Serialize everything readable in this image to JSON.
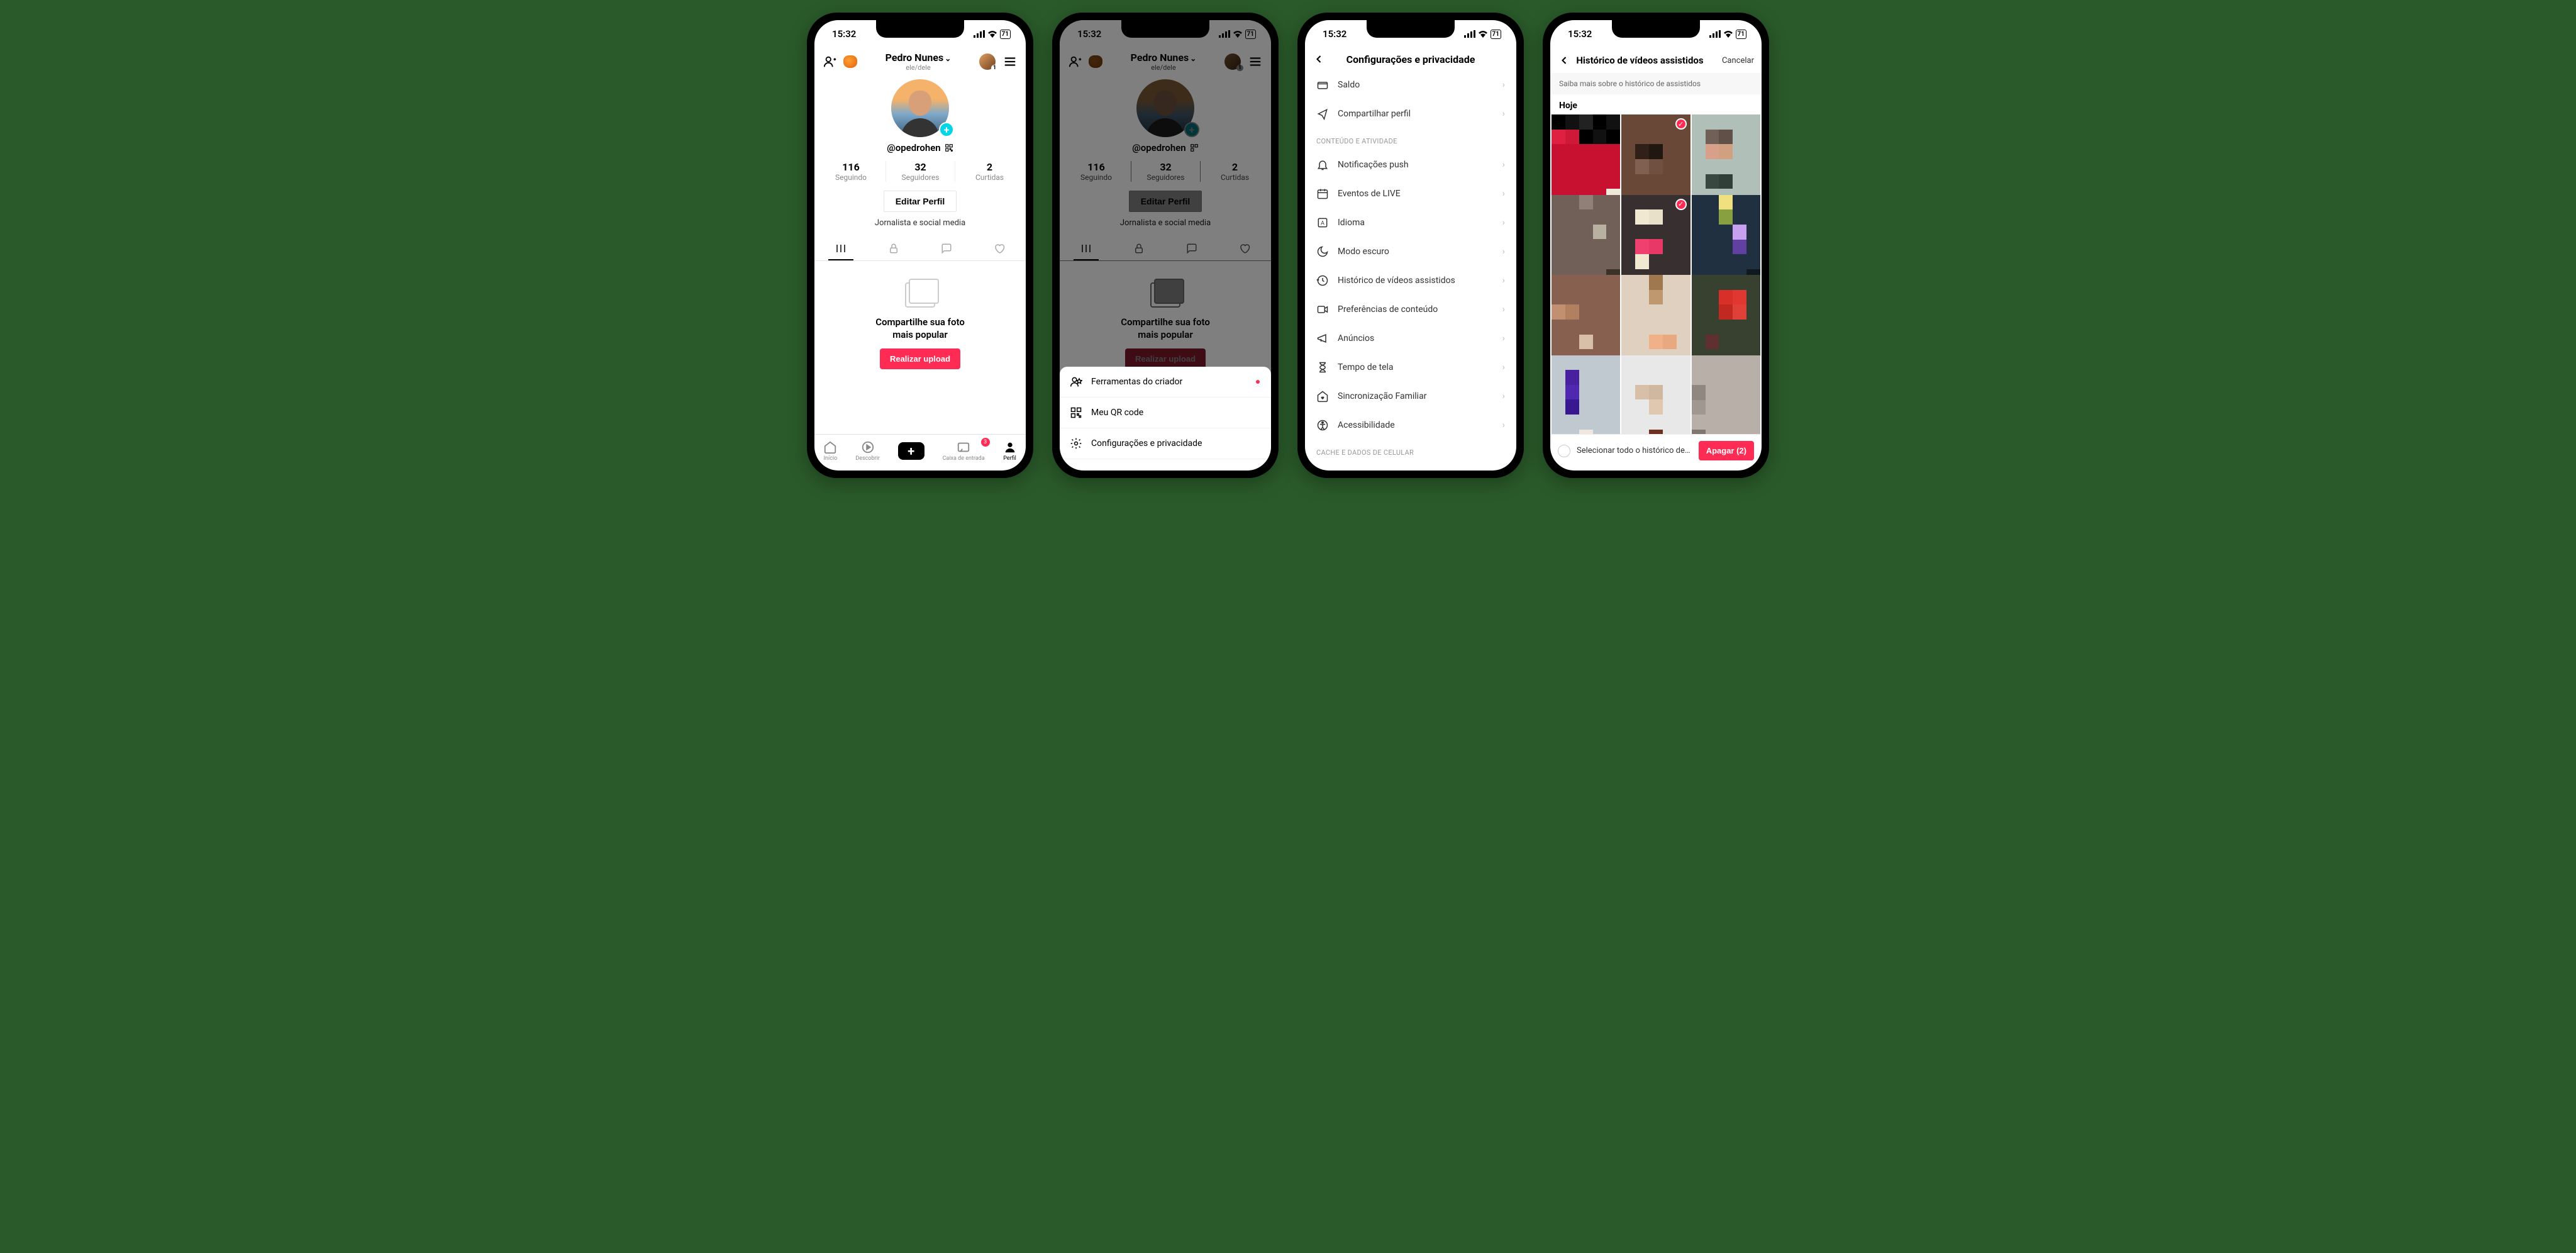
{
  "status": {
    "time": "15:32",
    "battery": "71"
  },
  "profile": {
    "display_name": "Pedro Nunes",
    "pronouns": "ele/dele",
    "username": "@opedrohen",
    "stats": {
      "following": {
        "value": "116",
        "label": "Seguindo"
      },
      "followers": {
        "value": "32",
        "label": "Seguidores"
      },
      "likes": {
        "value": "2",
        "label": "Curtidas"
      }
    },
    "edit_button": "Editar Perfil",
    "bio": "Jornalista e social media",
    "empty": {
      "title_line1": "Compartilhe sua foto",
      "title_line2": "mais popular",
      "upload_button": "Realizar upload"
    },
    "account_switch_badge": "1"
  },
  "nav": {
    "home": "Início",
    "discover": "Descobrir",
    "inbox": "Caixa de entrada",
    "inbox_badge": "3",
    "profile": "Perfil"
  },
  "sheet": {
    "items": [
      {
        "label": "Ferramentas do criador",
        "icon": "creator-tools-icon",
        "dot": true
      },
      {
        "label": "Meu QR code",
        "icon": "qr-code-icon",
        "dot": false
      },
      {
        "label": "Configurações e privacidade",
        "icon": "gear-icon",
        "dot": false
      }
    ]
  },
  "settings": {
    "title": "Configurações e privacidade",
    "top_rows": [
      {
        "label": "Saldo",
        "icon": "wallet-icon"
      },
      {
        "label": "Compartilhar perfil",
        "icon": "share-icon"
      }
    ],
    "section1_title": "CONTEÚDO E ATIVIDADE",
    "section1_rows": [
      {
        "label": "Notificações push",
        "icon": "bell-icon"
      },
      {
        "label": "Eventos de LIVE",
        "icon": "calendar-icon"
      },
      {
        "label": "Idioma",
        "icon": "language-icon"
      },
      {
        "label": "Modo escuro",
        "icon": "moon-icon"
      },
      {
        "label": "Histórico de vídeos assistidos",
        "icon": "history-icon"
      },
      {
        "label": "Preferências de conteúdo",
        "icon": "video-icon"
      },
      {
        "label": "Anúncios",
        "icon": "megaphone-icon"
      },
      {
        "label": "Tempo de tela",
        "icon": "hourglass-icon"
      },
      {
        "label": "Sincronização Familiar",
        "icon": "home-heart-icon"
      },
      {
        "label": "Acessibilidade",
        "icon": "accessibility-icon"
      }
    ],
    "section2_title": "CACHE E DADOS DE CELULAR"
  },
  "history": {
    "title": "Histórico de vídeos assistidos",
    "cancel": "Cancelar",
    "info": "Saiba mais sobre o histórico de assistidos",
    "date_label": "Hoje",
    "select_all": "Selecionar todo o histórico de assis...",
    "delete_button": "Apagar (2)",
    "selected_count": 2,
    "thumbs": [
      {
        "selected": false
      },
      {
        "selected": true
      },
      {
        "selected": false
      },
      {
        "selected": false
      },
      {
        "selected": true
      },
      {
        "selected": false
      },
      {
        "selected": false
      },
      {
        "selected": false
      },
      {
        "selected": false
      },
      {
        "selected": false
      },
      {
        "selected": false
      },
      {
        "selected": false
      }
    ]
  }
}
